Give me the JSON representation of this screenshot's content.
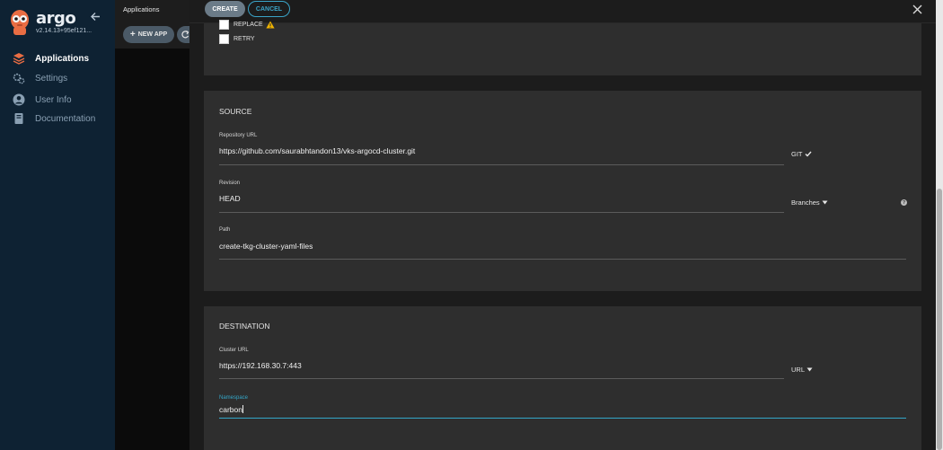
{
  "sidebar": {
    "brand": "argo",
    "version": "v2.14.13+95ef121...",
    "items": [
      {
        "label": "Applications",
        "icon": "stack-icon"
      },
      {
        "label": "Settings",
        "icon": "gears-icon"
      },
      {
        "label": "User Info",
        "icon": "user-circle-icon"
      },
      {
        "label": "Documentation",
        "icon": "book-icon"
      }
    ]
  },
  "background_page": {
    "breadcrumb": "Applications",
    "new_app_label": "NEW APP"
  },
  "panel": {
    "create_label": "CREATE",
    "cancel_label": "CANCEL",
    "sync_options": {
      "replace_label": "REPLACE",
      "retry_label": "RETRY"
    },
    "source": {
      "title": "SOURCE",
      "repo_url_label": "Repository URL",
      "repo_url_value": "https://github.com/saurabhtandon13/vks-argocd-cluster.git",
      "repo_type": "GIT",
      "revision_label": "Revision",
      "revision_value": "HEAD",
      "revision_mode": "Branches",
      "path_label": "Path",
      "path_value": "create-tkg-cluster-yaml-files"
    },
    "destination": {
      "title": "DESTINATION",
      "cluster_url_label": "Cluster URL",
      "cluster_url_value": "https://192.168.30.7:443",
      "cluster_mode": "URL",
      "namespace_label": "Namespace",
      "namespace_value": "carbon"
    }
  },
  "colors": {
    "sidebar_bg": "#0e2233",
    "panel_bg": "#1c1c1c",
    "card_bg": "#2e2e2e",
    "accent": "#33a6c8",
    "warning": "#f0b400"
  }
}
